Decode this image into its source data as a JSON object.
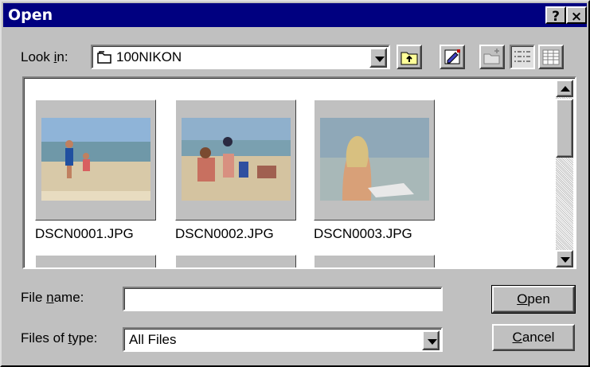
{
  "window": {
    "title": "Open",
    "help_label": "?",
    "close_label": "×"
  },
  "look_in": {
    "label_pre": "Look ",
    "label_key": "i",
    "label_post": "n:",
    "value": "100NIKON"
  },
  "toolbar": {
    "icons": [
      "up-one-level-icon",
      "desktop-icon",
      "create-new-folder-icon",
      "list-view-icon",
      "details-view-icon"
    ]
  },
  "files": [
    {
      "name": "DSCN0001.JPG"
    },
    {
      "name": "DSCN0002.JPG"
    },
    {
      "name": "DSCN0003.JPG"
    }
  ],
  "file_name": {
    "label_pre": "File ",
    "label_key": "n",
    "label_post": "ame:",
    "value": ""
  },
  "file_type": {
    "label_pre": "Files of ",
    "label_key": "t",
    "label_post": "ype:",
    "value": "All Files"
  },
  "buttons": {
    "open_key": "O",
    "open_rest": "pen",
    "cancel_pre": "",
    "cancel_key": "C",
    "cancel_rest": "ancel"
  },
  "colors": {
    "titlebar": "#000080",
    "face": "#c0c0c0"
  }
}
